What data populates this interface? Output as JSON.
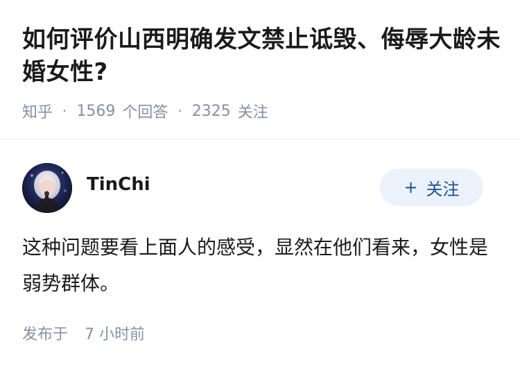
{
  "question": {
    "title": "如何评价山西明确发文禁止诋毁、侮辱大龄未婚女性?",
    "source": "知乎",
    "separator": "·",
    "answer_count": "1569",
    "answer_label": "个回答",
    "follow_count": "2325",
    "follow_label": "关注"
  },
  "answer": {
    "author_name": "TinChi",
    "avatar_icon": "user-avatar",
    "follow_button_label": "关注",
    "follow_button_icon": "plus-icon",
    "content": "这种问题要看上面人的感受，显然在他们看来，女性是弱势群体。",
    "published_label": "发布于",
    "published_time": "7 小时前"
  },
  "colors": {
    "title": "#1a1a1a",
    "meta": "#8590a6",
    "follow_button_bg": "#ebf2fb",
    "follow_button_text": "#175199",
    "divider": "#ececec"
  }
}
